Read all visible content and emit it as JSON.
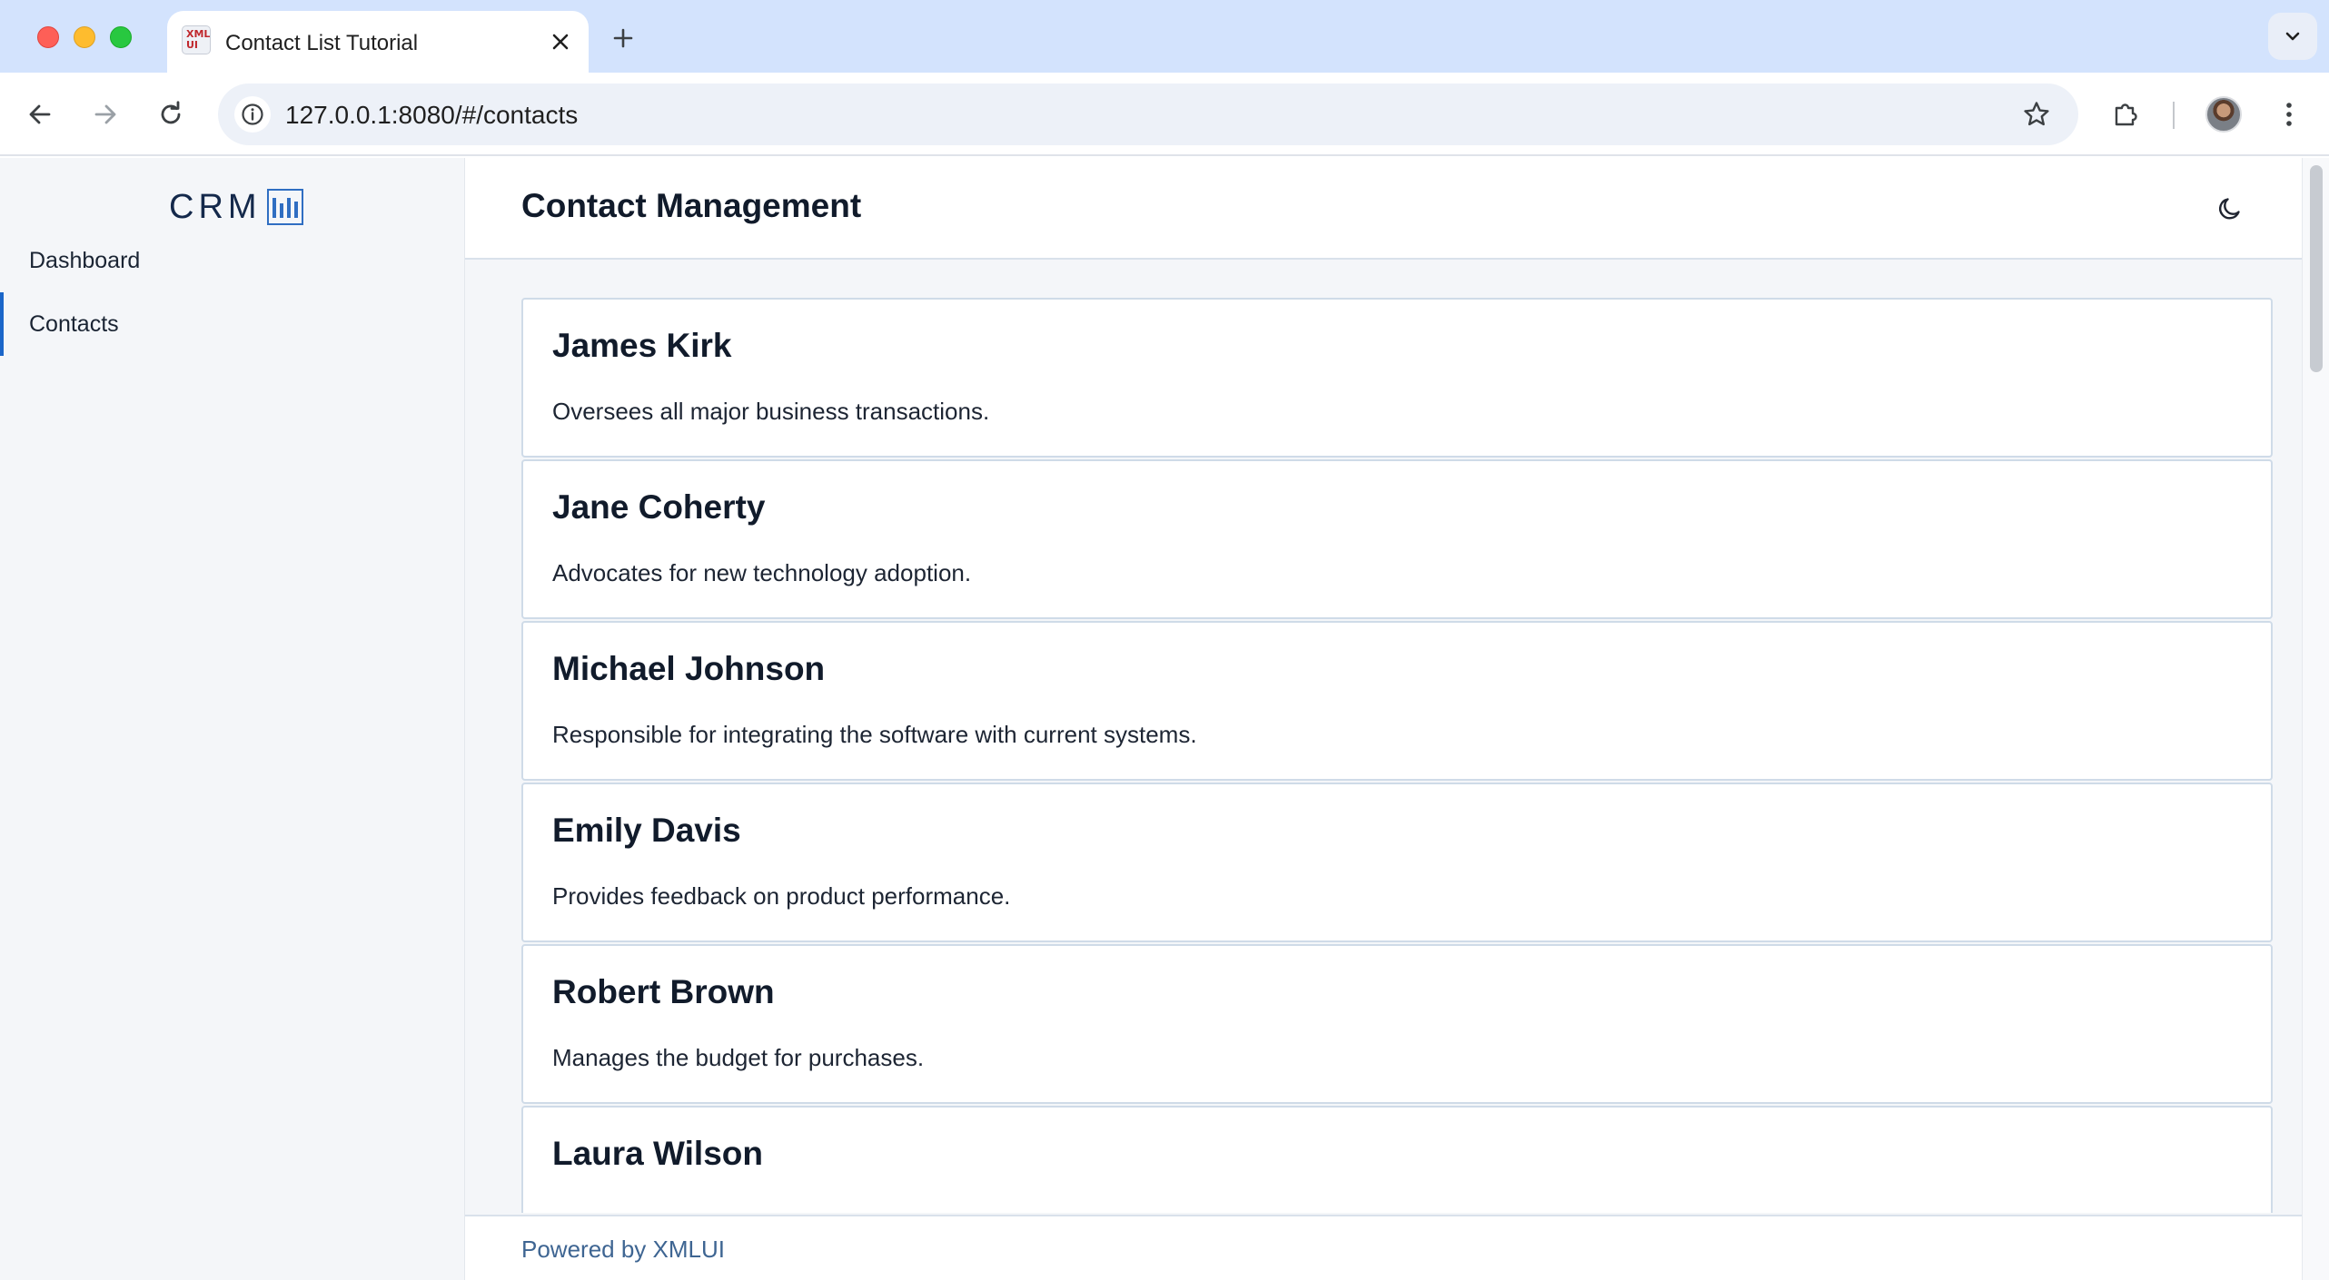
{
  "browser": {
    "tab": {
      "favicon_text": "XML UI",
      "title": "Contact List Tutorial"
    },
    "url": "127.0.0.1:8080/#/contacts"
  },
  "app": {
    "logo": "CRM",
    "nav": [
      {
        "label": "Dashboard",
        "active": false
      },
      {
        "label": "Contacts",
        "active": true
      }
    ],
    "page_title": "Contact Management",
    "contacts": [
      {
        "name": "James Kirk",
        "description": "Oversees all major business transactions."
      },
      {
        "name": "Jane Coherty",
        "description": "Advocates for new technology adoption."
      },
      {
        "name": "Michael Johnson",
        "description": "Responsible for integrating the software with current systems."
      },
      {
        "name": "Emily Davis",
        "description": "Provides feedback on product performance."
      },
      {
        "name": "Robert Brown",
        "description": "Manages the budget for purchases."
      },
      {
        "name": "Laura Wilson",
        "description": ""
      }
    ],
    "footer": "Powered by XMLUI"
  },
  "icons": {
    "theme_toggle": "moon-icon",
    "star": "star-icon",
    "extensions": "puzzle-icon"
  },
  "colors": {
    "accent": "#1b66c9",
    "card_border": "#cfdbe8",
    "footer_link": "#3e6592"
  }
}
